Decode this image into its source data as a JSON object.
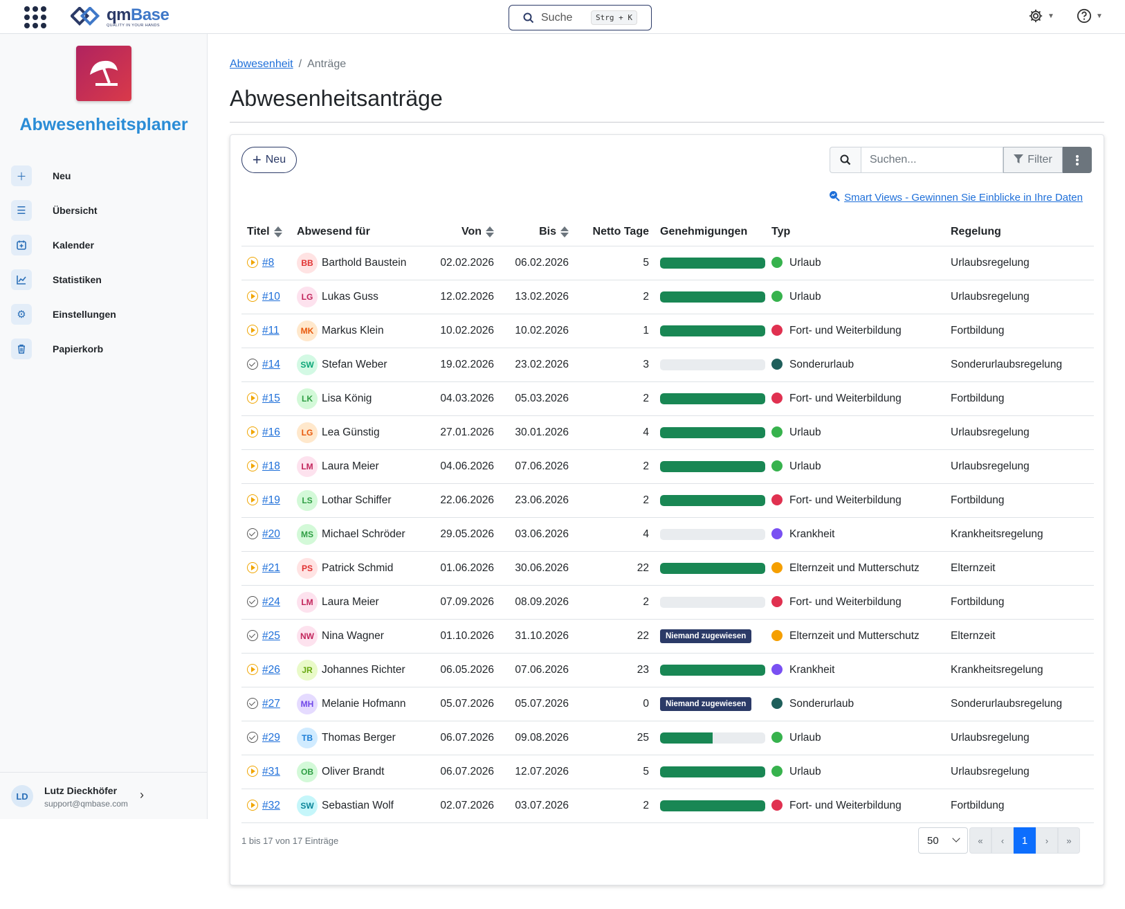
{
  "topbar": {
    "logo_name_a": "qm",
    "logo_name_b": "Base",
    "logo_tagline": "QUALITY IN YOUR HANDS",
    "search_label": "Suche",
    "search_shortcut": "Strg + K",
    "icons": [
      "apps-grid-icon",
      "gear-icon",
      "help-icon"
    ]
  },
  "sidebar": {
    "app_title": "Abwesenheitsplaner",
    "items": [
      {
        "label": "Neu",
        "icon": "plus-icon"
      },
      {
        "label": "Übersicht",
        "icon": "list-icon"
      },
      {
        "label": "Kalender",
        "icon": "calendar-icon"
      },
      {
        "label": "Statistiken",
        "icon": "chart-icon"
      },
      {
        "label": "Einstellungen",
        "icon": "gear-icon"
      },
      {
        "label": "Papierkorb",
        "icon": "trash-icon"
      }
    ],
    "user": {
      "initials": "LD",
      "name": "Lutz Dieckhöfer",
      "email": "support@qmbase.com"
    }
  },
  "breadcrumb": {
    "parent": "Abwesenheit",
    "current": "Anträge"
  },
  "page_title": "Abwesenheitsanträge",
  "toolbar": {
    "new_label": "Neu",
    "search_placeholder": "Suchen...",
    "filter_label": "Filter",
    "smart_views_label": "Smart Views - Gewinnen Sie Einblicke in Ihre Daten"
  },
  "table": {
    "headers": {
      "title": "Titel",
      "who": "Abwesend für",
      "from": "Von",
      "to": "Bis",
      "days": "Netto Tage",
      "approvals": "Genehmigungen",
      "type": "Typ",
      "rule": "Regelung"
    },
    "rows": [
      {
        "status": "running",
        "id": "#8",
        "initials": "BB",
        "name": "Barthold Baustein",
        "from": "02.02.2026",
        "to": "06.02.2026",
        "days": "5",
        "approval": 1.0,
        "type": "Urlaub",
        "type_color": "#37b24d",
        "rule": "Urlaubsregelung",
        "av_bg": "#ffe3e3",
        "av_fg": "#e03131"
      },
      {
        "status": "running",
        "id": "#10",
        "initials": "LG",
        "name": "Lukas Guss",
        "from": "12.02.2026",
        "to": "13.02.2026",
        "days": "2",
        "approval": 1.0,
        "type": "Urlaub",
        "type_color": "#37b24d",
        "rule": "Urlaubsregelung",
        "av_bg": "#fde2ee",
        "av_fg": "#c2255c"
      },
      {
        "status": "running",
        "id": "#11",
        "initials": "MK",
        "name": "Markus Klein",
        "from": "10.02.2026",
        "to": "10.02.2026",
        "days": "1",
        "approval": 1.0,
        "type": "Fort- und Weiterbildung",
        "type_color": "#e03150",
        "rule": "Fortbildung",
        "av_bg": "#ffe8cc",
        "av_fg": "#e8590c"
      },
      {
        "status": "done",
        "id": "#14",
        "initials": "SW",
        "name": "Stefan Weber",
        "from": "19.02.2026",
        "to": "23.02.2026",
        "days": "3",
        "approval": 0.0,
        "type": "Sonderurlaub",
        "type_color": "#1f5f5b",
        "rule": "Sonderurlaubsregelung",
        "av_bg": "#d3f9e4",
        "av_fg": "#0ca678"
      },
      {
        "status": "running",
        "id": "#15",
        "initials": "LK",
        "name": "Lisa König",
        "from": "04.03.2026",
        "to": "05.03.2026",
        "days": "2",
        "approval": 1.0,
        "type": "Fort- und Weiterbildung",
        "type_color": "#e03150",
        "rule": "Fortbildung",
        "av_bg": "#d3f9d8",
        "av_fg": "#2f9e44"
      },
      {
        "status": "running",
        "id": "#16",
        "initials": "LG",
        "name": "Lea Günstig",
        "from": "27.01.2026",
        "to": "30.01.2026",
        "days": "4",
        "approval": 1.0,
        "type": "Urlaub",
        "type_color": "#37b24d",
        "rule": "Urlaubsregelung",
        "av_bg": "#ffe8cc",
        "av_fg": "#e8590c"
      },
      {
        "status": "running",
        "id": "#18",
        "initials": "LM",
        "name": "Laura Meier",
        "from": "04.06.2026",
        "to": "07.06.2026",
        "days": "2",
        "approval": 1.0,
        "type": "Urlaub",
        "type_color": "#37b24d",
        "rule": "Urlaubsregelung",
        "av_bg": "#fde2ee",
        "av_fg": "#c2255c"
      },
      {
        "status": "running",
        "id": "#19",
        "initials": "LS",
        "name": "Lothar Schiffer",
        "from": "22.06.2026",
        "to": "23.06.2026",
        "days": "2",
        "approval": 1.0,
        "type": "Fort- und Weiterbildung",
        "type_color": "#e03150",
        "rule": "Fortbildung",
        "av_bg": "#d3f9d8",
        "av_fg": "#2f9e44"
      },
      {
        "status": "done",
        "id": "#20",
        "initials": "MS",
        "name": "Michael Schröder",
        "from": "29.05.2026",
        "to": "03.06.2026",
        "days": "4",
        "approval": 0.0,
        "type": "Krankheit",
        "type_color": "#7950f2",
        "rule": "Krankheitsregelung",
        "av_bg": "#d3f9d8",
        "av_fg": "#2f9e44"
      },
      {
        "status": "running",
        "id": "#21",
        "initials": "PS",
        "name": "Patrick Schmid",
        "from": "01.06.2026",
        "to": "30.06.2026",
        "days": "22",
        "approval": 1.0,
        "type": "Elternzeit und Mutterschutz",
        "type_color": "#f59f00",
        "rule": "Elternzeit",
        "av_bg": "#ffe3e3",
        "av_fg": "#e03131"
      },
      {
        "status": "done",
        "id": "#24",
        "initials": "LM",
        "name": "Laura Meier",
        "from": "07.09.2026",
        "to": "08.09.2026",
        "days": "2",
        "approval": 0.0,
        "type": "Fort- und Weiterbildung",
        "type_color": "#e03150",
        "rule": "Fortbildung",
        "av_bg": "#fde2ee",
        "av_fg": "#c2255c"
      },
      {
        "status": "done",
        "id": "#25",
        "initials": "NW",
        "name": "Nina Wagner",
        "from": "01.10.2026",
        "to": "31.10.2026",
        "days": "22",
        "approval": null,
        "badge": "Niemand zugewiesen",
        "type": "Elternzeit und Mutterschutz",
        "type_color": "#f59f00",
        "rule": "Elternzeit",
        "av_bg": "#fde2ee",
        "av_fg": "#c2255c"
      },
      {
        "status": "running",
        "id": "#26",
        "initials": "JR",
        "name": "Johannes Richter",
        "from": "06.05.2026",
        "to": "07.06.2026",
        "days": "23",
        "approval": 1.0,
        "type": "Krankheit",
        "type_color": "#7950f2",
        "rule": "Krankheitsregelung",
        "av_bg": "#e9fac8",
        "av_fg": "#66a80f"
      },
      {
        "status": "done",
        "id": "#27",
        "initials": "MH",
        "name": "Melanie Hofmann",
        "from": "05.07.2026",
        "to": "05.07.2026",
        "days": "0",
        "approval": null,
        "badge": "Niemand zugewiesen",
        "type": "Sonderurlaub",
        "type_color": "#1f5f5b",
        "rule": "Sonderurlaubsregelung",
        "av_bg": "#e5dbff",
        "av_fg": "#7048e8"
      },
      {
        "status": "done",
        "id": "#29",
        "initials": "TB",
        "name": "Thomas Berger",
        "from": "06.07.2026",
        "to": "09.08.2026",
        "days": "25",
        "approval": 0.5,
        "type": "Urlaub",
        "type_color": "#37b24d",
        "rule": "Urlaubsregelung",
        "av_bg": "#d0ebff",
        "av_fg": "#1c7ed6"
      },
      {
        "status": "running",
        "id": "#31",
        "initials": "OB",
        "name": "Oliver Brandt",
        "from": "06.07.2026",
        "to": "12.07.2026",
        "days": "5",
        "approval": 1.0,
        "type": "Urlaub",
        "type_color": "#37b24d",
        "rule": "Urlaubsregelung",
        "av_bg": "#d3f9d8",
        "av_fg": "#2f9e44"
      },
      {
        "status": "running",
        "id": "#32",
        "initials": "SW",
        "name": "Sebastian Wolf",
        "from": "02.07.2026",
        "to": "03.07.2026",
        "days": "2",
        "approval": 1.0,
        "type": "Fort- und Weiterbildung",
        "type_color": "#e03150",
        "rule": "Fortbildung",
        "av_bg": "#c5f6fa",
        "av_fg": "#0c8599"
      }
    ]
  },
  "footer": {
    "info": "1 bis 17 von 17 Einträge",
    "page_size": "50",
    "pager": [
      "«",
      "‹",
      "1",
      "›",
      "»"
    ],
    "current_page": "1"
  },
  "colors": {
    "accent": "#2a8cd6",
    "primary": "#0d6efd",
    "success": "#198754",
    "navy": "#2b3a67"
  }
}
